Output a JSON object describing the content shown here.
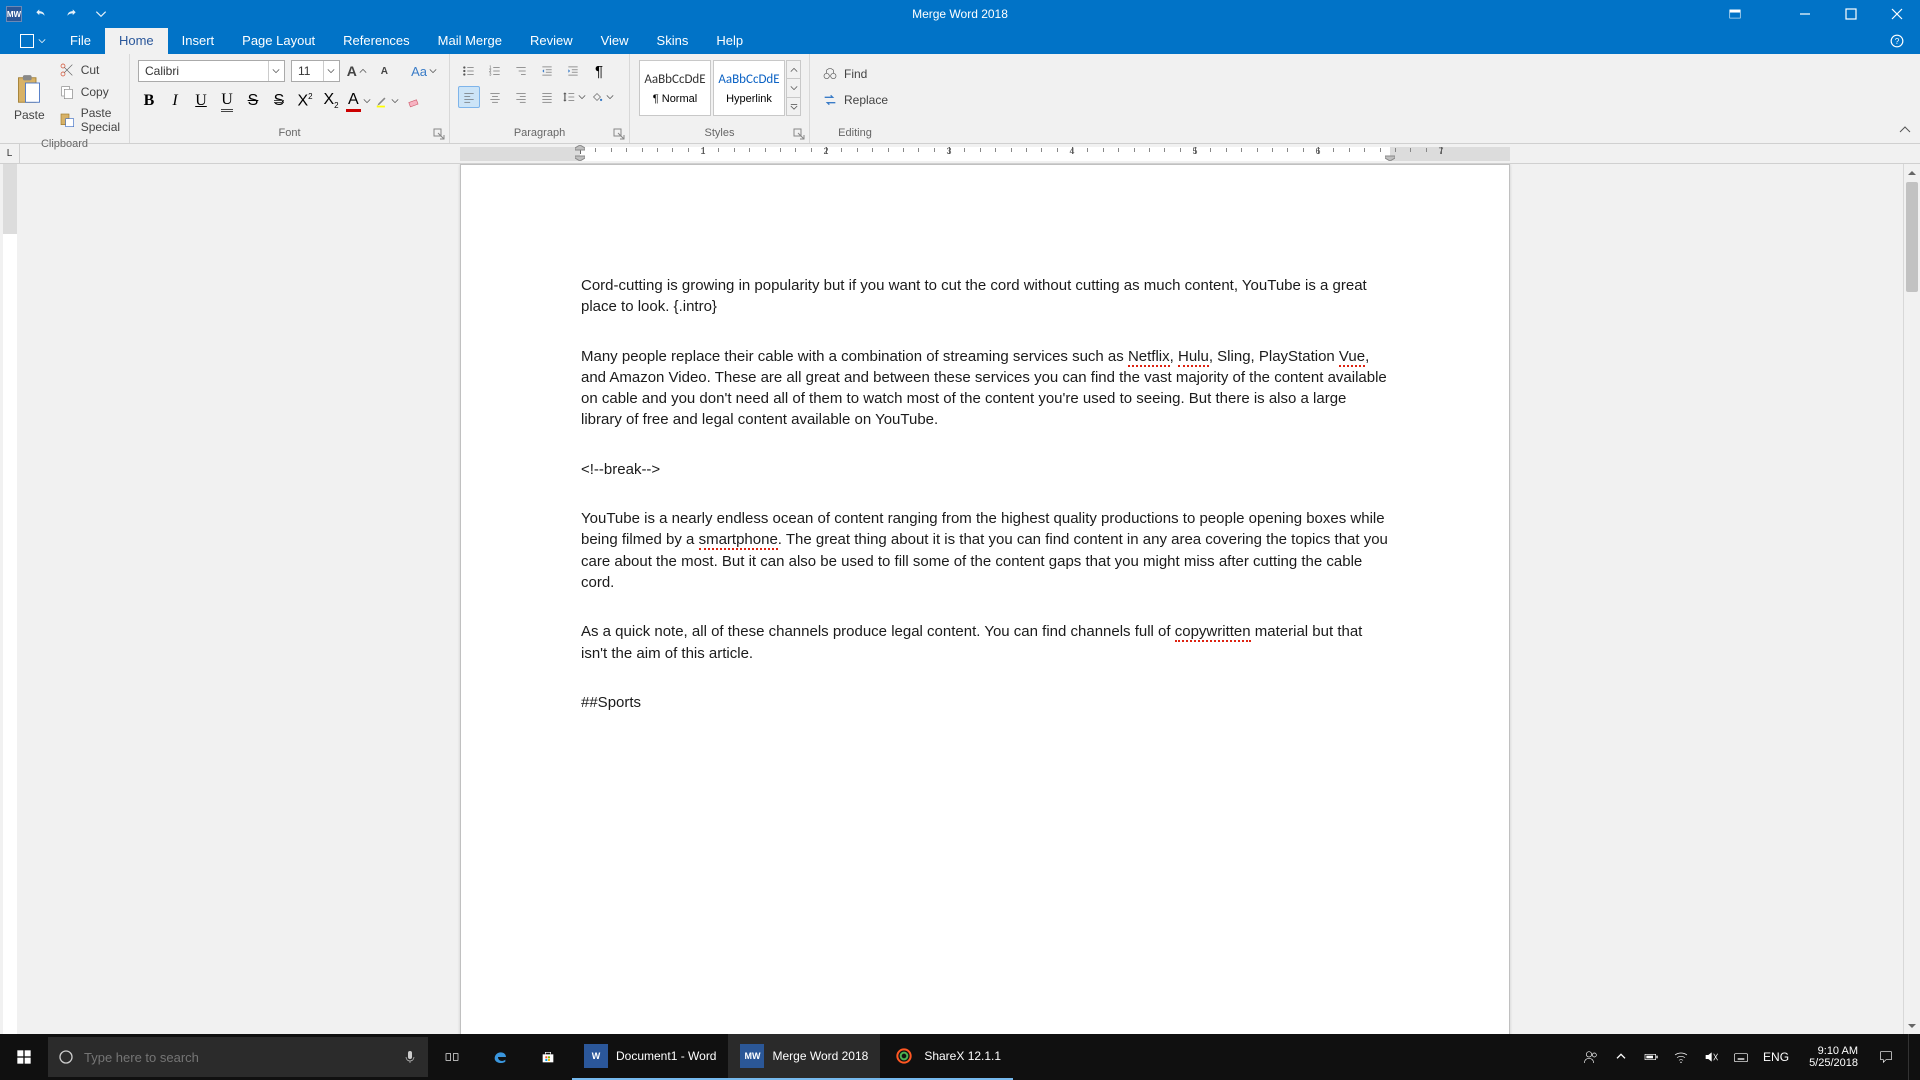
{
  "titlebar": {
    "app_abbrev": "MW",
    "title": "Merge Word 2018"
  },
  "tabs": {
    "file": "File",
    "items": [
      "Home",
      "Insert",
      "Page Layout",
      "References",
      "Mail Merge",
      "Review",
      "View",
      "Skins",
      "Help"
    ],
    "active_index": 0
  },
  "ribbon": {
    "clipboard": {
      "paste": "Paste",
      "cut": "Cut",
      "copy": "Copy",
      "paste_special": "Paste Special",
      "label": "Clipboard"
    },
    "font": {
      "name": "Calibri",
      "size": "11",
      "label": "Font",
      "change_case": "Aa"
    },
    "paragraph": {
      "label": "Paragraph"
    },
    "styles": {
      "label": "Styles",
      "sample": "AaBbCcDdE",
      "items": [
        {
          "name": "¶ Normal",
          "color": "#333333"
        },
        {
          "name": "Hyperlink",
          "color": "#0b62c4"
        }
      ]
    },
    "editing": {
      "find": "Find",
      "replace": "Replace",
      "label": "Editing"
    }
  },
  "ruler": {
    "corner": "L",
    "numbers": [
      1,
      2,
      3,
      4,
      5,
      6,
      7
    ]
  },
  "document": {
    "paragraphs": [
      "Cord-cutting is growing in popularity but if you want to cut the cord without cutting as much content, YouTube is a great place to look. {.intro}",
      "Many people replace their cable with a combination of streaming services such as Netflix, Hulu, Sling, PlayStation Vue, and Amazon Video. These are all great and between these services you can find the vast majority of the content available on cable and you don't need all of them to watch most of the content you're used to seeing. But there is also a large library of free and legal content available on YouTube.",
      "<!--break-->",
      "YouTube is a nearly endless ocean of content ranging from the highest quality productions to people opening boxes while being filmed by a smartphone. The great thing about it is that you can find content in any area covering the topics that you care about the most. But it can also be used to fill some of the content gaps that you might miss after cutting the cable cord.",
      "As a quick note, all of these channels produce legal content. You can find channels full of copywritten material but that isn't the aim of this article.",
      "##Sports"
    ],
    "spell_errors": [
      "Netflix",
      "Hulu",
      "Vue",
      "smartphone",
      "copywritten"
    ]
  },
  "taskbar": {
    "search_placeholder": "Type here to search",
    "apps": [
      {
        "id": "word",
        "label": "Document1 - Word",
        "state": "open"
      },
      {
        "id": "mergeword",
        "label": "Merge Word 2018",
        "state": "active"
      },
      {
        "id": "sharex",
        "label": "ShareX 12.1.1",
        "state": "open"
      }
    ],
    "lang": "ENG",
    "time": "9:10 AM",
    "date": "5/25/2018"
  }
}
